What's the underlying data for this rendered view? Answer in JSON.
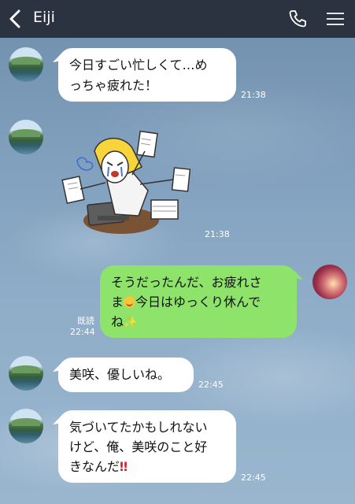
{
  "header": {
    "title": "Eiji",
    "icons": [
      "chevron-left-icon",
      "phone-icon",
      "menu-icon"
    ]
  },
  "messages": [
    {
      "side": "in",
      "lines": [
        "今日すごい忙しくて…め",
        "っちゃ疲れた！"
      ],
      "time": "21:38"
    },
    {
      "side": "in",
      "type": "sticker",
      "time": "21:38"
    },
    {
      "side": "out",
      "lines": [
        "そうだったんだ、お疲れさ",
        "ま",
        "今日はゆっくり休んで",
        "ね"
      ],
      "read": "既読",
      "time": "22:44",
      "emoji": [
        "smiling-face",
        "sparkles"
      ]
    },
    {
      "side": "in",
      "lines": [
        "美咲、優しいね。"
      ],
      "time": "22:45"
    },
    {
      "side": "in",
      "lines": [
        "気づいてたかもしれない",
        "けど、俺、美咲のこと好",
        "きなんだ"
      ],
      "time": "22:45",
      "emoji": [
        "double-exclamation"
      ]
    }
  ],
  "colors": {
    "header_bg": "#2c3340",
    "incoming_bubble": "#ffffff",
    "outgoing_bubble": "#8ee36b",
    "background": "#7f9fbd"
  }
}
